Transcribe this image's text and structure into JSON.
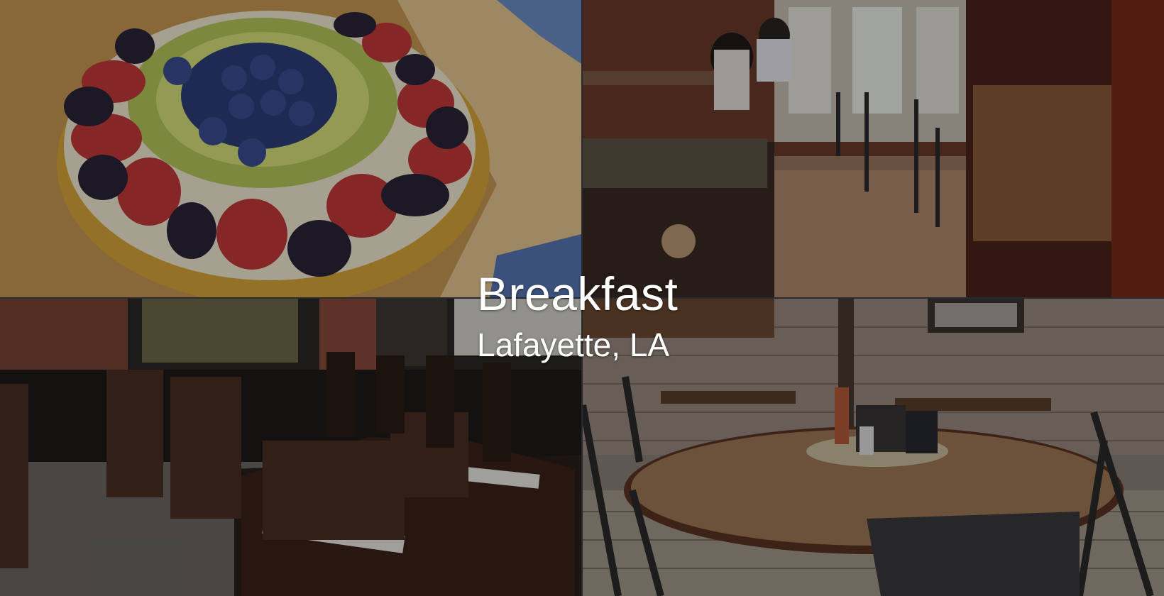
{
  "caption": {
    "title": "Breakfast",
    "subtitle": "Lafayette, LA"
  },
  "tiles": [
    {
      "subject": "fruit-tart"
    },
    {
      "subject": "dining-room-window"
    },
    {
      "subject": "bar-dining-room"
    },
    {
      "subject": "round-table-brick-wall"
    }
  ]
}
